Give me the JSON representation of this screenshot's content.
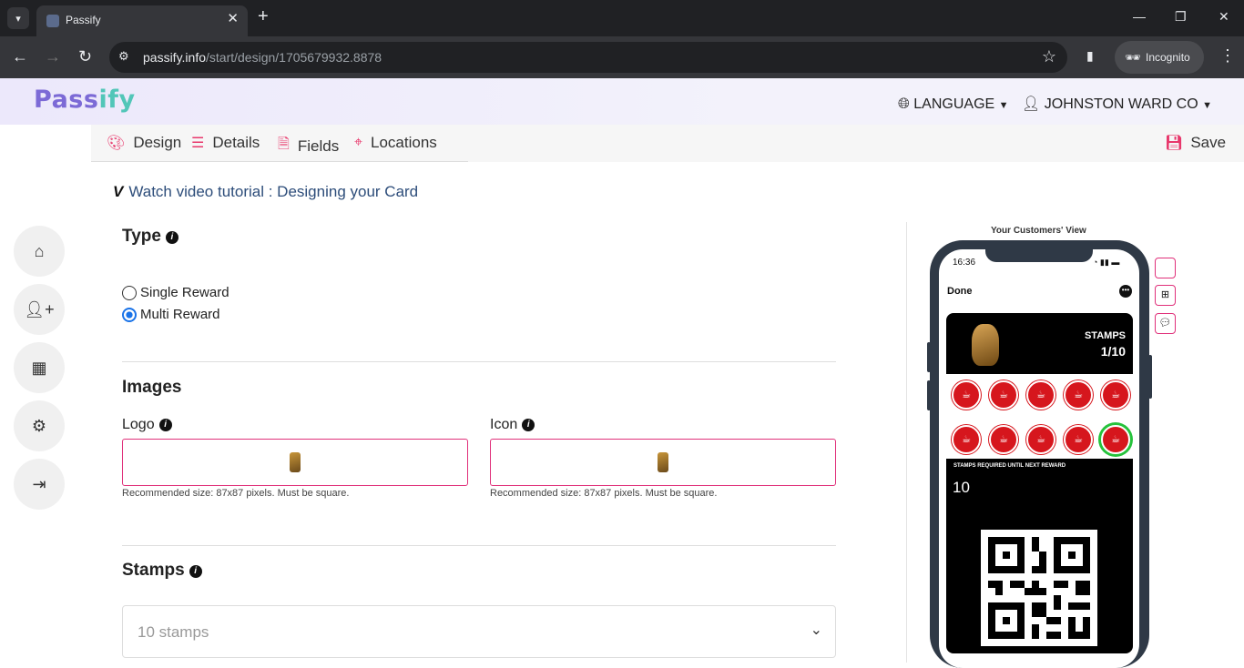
{
  "browser": {
    "tab_title": "Passify",
    "url_host": "passify.info",
    "url_path": "/start/design/1705679932.8878",
    "incognito_label": "Incognito"
  },
  "header": {
    "logo_left": "Pass",
    "logo_right": "ify",
    "language": "LANGUAGE",
    "user": "JOHNSTON WARD CO"
  },
  "subnav": {
    "items": [
      {
        "label": "Design",
        "icon": "palette-icon"
      },
      {
        "label": "Details",
        "icon": "list-icon"
      },
      {
        "label": "Fields",
        "icon": "file-icon"
      },
      {
        "label": "Locations",
        "icon": "map-pin-icon"
      }
    ],
    "save": "Save"
  },
  "tutorial": "Watch video tutorial : Designing your Card",
  "sidebar": [
    "home-icon",
    "add-user-icon",
    "dashboard-icon",
    "settings-icon",
    "logout-icon"
  ],
  "type": {
    "heading": "Type",
    "options": [
      "Single Reward",
      "Multi Reward"
    ],
    "selected": "Multi Reward"
  },
  "images": {
    "heading": "Images",
    "logo_label": "Logo",
    "icon_label": "Icon",
    "hint": "Recommended size: 87x87 pixels. Must be square."
  },
  "stamps": {
    "heading": "Stamps",
    "value": "10 stamps"
  },
  "preview": {
    "title": "Your Customers' View",
    "time": "16:36",
    "done": "Done",
    "stamps_label": "STAMPS",
    "stamps_value": "1/10",
    "required_label": "STAMPS REQUIRED UNTIL NEXT REWARD",
    "required_value": "10"
  },
  "colors": {
    "accent": "#e8386c",
    "link": "#2d4d7a",
    "stamp": "#d6161d"
  }
}
